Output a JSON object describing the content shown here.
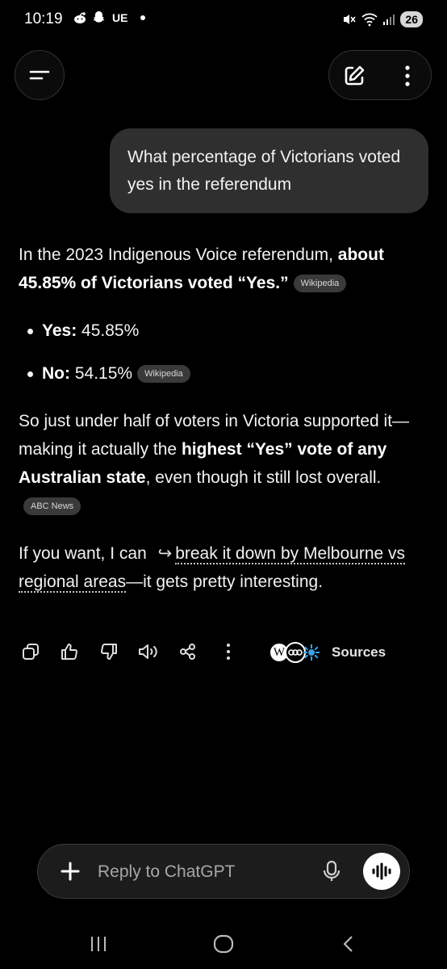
{
  "status_bar": {
    "time": "10:19",
    "carrier": "UE",
    "battery": "26"
  },
  "header": {
    "menu_icon": "menu-icon",
    "edit_icon": "edit-icon",
    "more_icon": "more-vertical-icon"
  },
  "user_message": {
    "text": "What percentage of Victorians voted yes in the referendum"
  },
  "assistant": {
    "p1_text": "In the 2023 Indigenous Voice referendum, ",
    "p1_bold": "about 45.85% of Victorians voted “Yes.”",
    "p1_source": "Wikipedia",
    "bullets": [
      {
        "label": "Yes:",
        "value": " 45.85%",
        "source": ""
      },
      {
        "label": "No:",
        "value": " 54.15%",
        "source": "Wikipedia"
      }
    ],
    "p2_a": "So just under half of voters in Victoria supported it—making it actually the ",
    "p2_bold": "highest “Yes” vote of any Australian state",
    "p2_b": ", even though it still lost overall.",
    "p2_source": "ABC News",
    "p3_a": "If you want, I can ",
    "p3_arrow": "↪",
    "p3_link": "break it down by Melbourne vs regional areas",
    "p3_b": "—it gets pretty interesting."
  },
  "actions": {
    "copy_icon": "copy-icon",
    "like_icon": "thumbs-up-icon",
    "dislike_icon": "thumbs-down-icon",
    "speak_icon": "speaker-icon",
    "share_icon": "share-icon",
    "more_icon": "more-vertical-icon",
    "sources_label": "Sources",
    "source_w": "W",
    "source_abc": "ABC"
  },
  "composer": {
    "placeholder": "Reply to ChatGPT",
    "plus_label": "+",
    "mic_icon": "microphone-icon",
    "voice_icon": "voice-mode-icon"
  },
  "navbar": {
    "recents_icon": "recents-icon",
    "home_icon": "home-icon",
    "back_icon": "back-icon"
  }
}
